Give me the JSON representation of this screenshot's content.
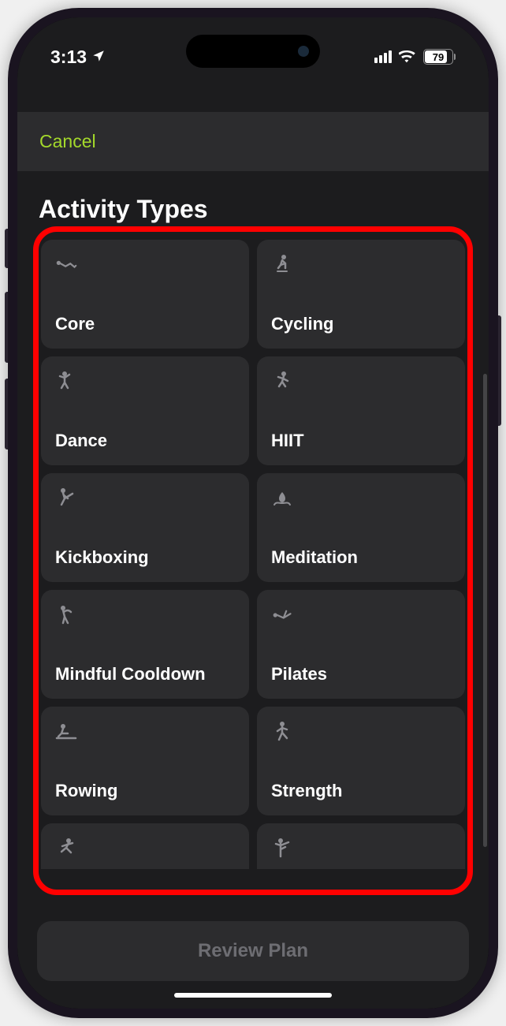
{
  "status_bar": {
    "time": "3:13",
    "location_icon": "location-arrow",
    "battery_percent": "79"
  },
  "nav": {
    "cancel_label": "Cancel"
  },
  "page": {
    "title": "Activity Types"
  },
  "activities": [
    {
      "icon": "core-icon",
      "label": "Core"
    },
    {
      "icon": "cycling-icon",
      "label": "Cycling"
    },
    {
      "icon": "dance-icon",
      "label": "Dance"
    },
    {
      "icon": "hiit-icon",
      "label": "HIIT"
    },
    {
      "icon": "kickboxing-icon",
      "label": "Kickboxing"
    },
    {
      "icon": "meditation-icon",
      "label": "Meditation"
    },
    {
      "icon": "mindful-cooldown-icon",
      "label": "Mindful Cooldown"
    },
    {
      "icon": "pilates-icon",
      "label": "Pilates"
    },
    {
      "icon": "rowing-icon",
      "label": "Rowing"
    },
    {
      "icon": "strength-icon",
      "label": "Strength"
    },
    {
      "icon": "running-icon",
      "label": ""
    },
    {
      "icon": "yoga-icon",
      "label": ""
    }
  ],
  "footer": {
    "review_label": "Review Plan"
  },
  "annotation": {
    "highlight_color": "#ff0000"
  }
}
